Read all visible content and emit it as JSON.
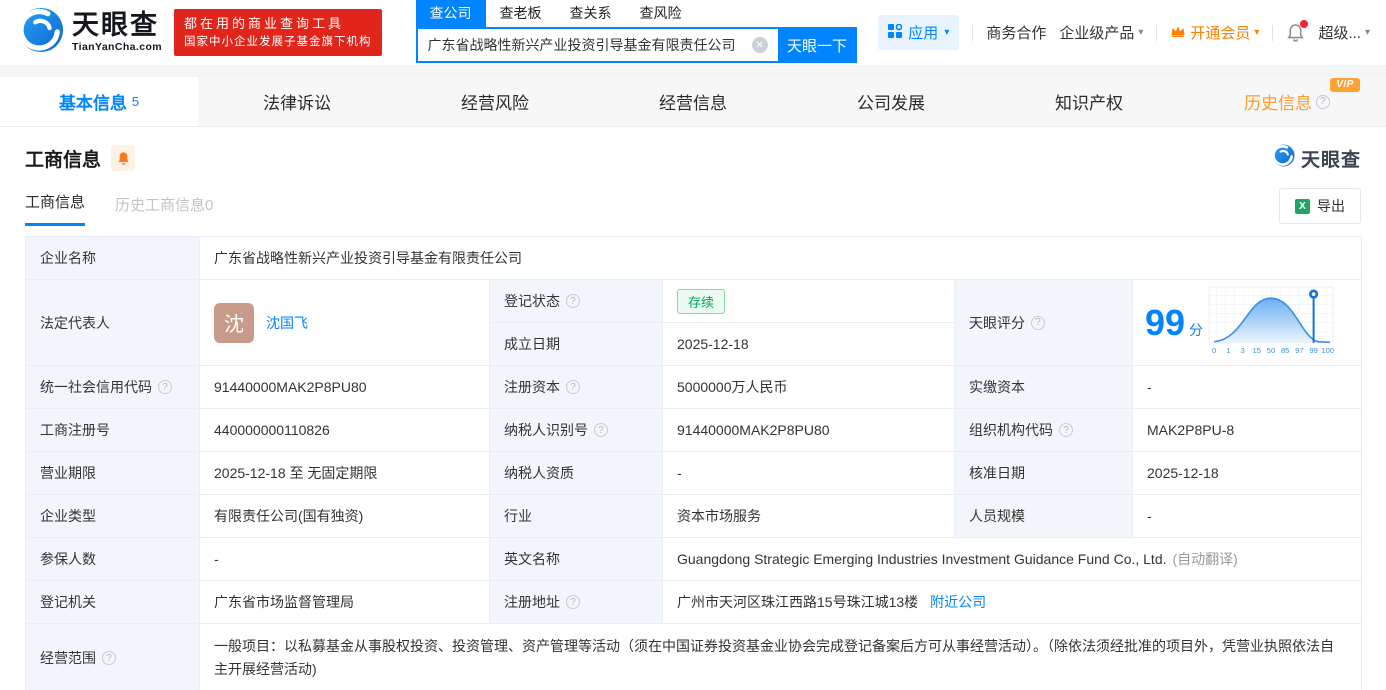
{
  "brand": {
    "logo_text": "天眼查",
    "logo_domain": "TianYanCha.com",
    "banner_line1": "都在用的商业查询工具",
    "banner_line2": "国家中小企业发展子基金旗下机构"
  },
  "header": {
    "search_tabs": [
      {
        "label": "查公司"
      },
      {
        "label": "查老板"
      },
      {
        "label": "查关系"
      },
      {
        "label": "查风险"
      }
    ],
    "search": {
      "value": "广东省战略性新兴产业投资引导基金有限责任公司",
      "button": "天眼一下"
    },
    "nav": {
      "apps": "应用",
      "cooperation": "商务合作",
      "enterprise": "企业级产品",
      "vip": "开通会员",
      "super": "超级..."
    }
  },
  "tabs": [
    {
      "label": "基本信息",
      "count": "5"
    },
    {
      "label": "法律诉讼"
    },
    {
      "label": "经营风险"
    },
    {
      "label": "经营信息"
    },
    {
      "label": "公司发展"
    },
    {
      "label": "知识产权"
    },
    {
      "label": "历史信息",
      "badge": "VIP"
    }
  ],
  "section": {
    "title": "工商信息",
    "watermark": "天眼查",
    "subtabs": [
      {
        "label": "工商信息"
      },
      {
        "label": "历史工商信息0"
      }
    ],
    "export_label": "导出"
  },
  "fields": {
    "company_name_label": "企业名称",
    "company_name": "广东省战略性新兴产业投资引导基金有限责任公司",
    "legal_rep_label": "法定代表人",
    "legal_rep_avatar": "沈",
    "legal_rep_name": "沈国飞",
    "reg_status_label": "登记状态",
    "reg_status": "存续",
    "establish_date_label": "成立日期",
    "establish_date": "2025-12-18",
    "score_label": "天眼评分",
    "credit_code_label": "统一社会信用代码",
    "credit_code": "91440000MAK2P8PU80",
    "reg_capital_label": "注册资本",
    "reg_capital": "5000000万人民币",
    "paid_capital_label": "实缴资本",
    "paid_capital": "-",
    "reg_number_label": "工商注册号",
    "reg_number": "440000000110826",
    "taxpayer_id_label": "纳税人识别号",
    "taxpayer_id": "91440000MAK2P8PU80",
    "org_code_label": "组织机构代码",
    "org_code": "MAK2P8PU-8",
    "business_term_label": "营业期限",
    "business_term": "2025-12-18 至 无固定期限",
    "taxpayer_quality_label": "纳税人资质",
    "taxpayer_quality": "-",
    "approval_date_label": "核准日期",
    "approval_date": "2025-12-18",
    "company_type_label": "企业类型",
    "company_type": "有限责任公司(国有独资)",
    "industry_label": "行业",
    "industry": "资本市场服务",
    "staff_size_label": "人员规模",
    "staff_size": "-",
    "insured_label": "参保人数",
    "insured": "-",
    "english_name_label": "英文名称",
    "english_name": "Guangdong Strategic Emerging Industries Investment Guidance Fund Co., Ltd.",
    "english_name_note": "(自动翻译)",
    "reg_authority_label": "登记机关",
    "reg_authority": "广东省市场监督管理局",
    "reg_address_label": "注册地址",
    "reg_address": "广州市天河区珠江西路15号珠江城13楼",
    "nearby_link": "附近公司",
    "business_scope_label": "经营范围",
    "business_scope": "一般项目：以私募基金从事股权投资、投资管理、资产管理等活动（须在中国证券投资基金业协会完成登记备案后方可从事经营活动）。（除依法须经批准的项目外，凭营业执照依法自主开展经营活动)"
  },
  "chart_data": {
    "type": "area",
    "title": "天眼评分",
    "score": "99",
    "score_unit": "分",
    "x_ticks": [
      "0",
      "1",
      "3",
      "15",
      "50",
      "85",
      "97",
      "99",
      "100"
    ],
    "marker_at": 99,
    "curve": "bell distribution peaking near tick 50, marker pin at 99",
    "accent_color": "#0084ff"
  },
  "colors": {
    "accent": "#0084ff",
    "banner_red": "#e1251b",
    "vip_orange": "#ff8000",
    "status_green": "#00a854",
    "label_bg": "#f2f6fc"
  }
}
